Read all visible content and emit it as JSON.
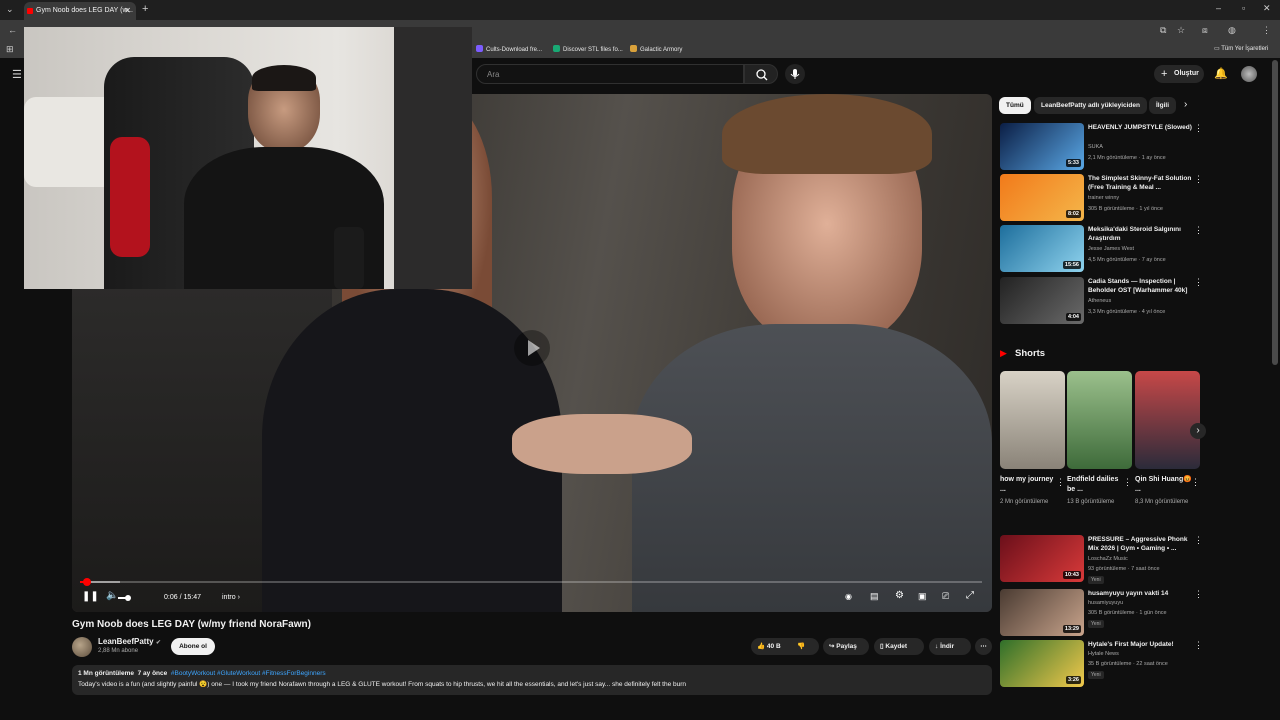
{
  "browser": {
    "tab_title": "Gym Noob does LEG DAY (w...",
    "bookmarks": [
      {
        "label": "Cults-Download fre...",
        "color": "#7c5cff"
      },
      {
        "label": "Discover STL files fo...",
        "color": "#19a974"
      },
      {
        "label": "Galactic Armory",
        "color": "#d9a13b"
      }
    ],
    "all_bookmarks": "Tüm Yer İşaretleri"
  },
  "header": {
    "search_placeholder": "Ara",
    "create_label": "Oluştur"
  },
  "player": {
    "time": "0:06 / 15:47",
    "chapter": "intro",
    "progress_fraction": 0.0063
  },
  "video": {
    "title": "Gym Noob does LEG DAY (w/my friend NoraFawn)",
    "channel": "LeanBeefPatty",
    "subscribers": "2,88 Mn abone",
    "subscribe_label": "Abone ol",
    "likes": "40 B",
    "share_label": "Paylaş",
    "save_label": "Kaydet",
    "download_label": "İndir",
    "desc_views": "1 Mn görüntüleme",
    "desc_age": "7 ay önce",
    "desc_tags": "#BootyWorkout #GluteWorkout #FitnessForBeginners",
    "desc_text": "Today's video is a fun (and slightly painful 😵) one — I took my friend Norafawn through a LEG & GLUTE workout! From squats to hip thrusts, we hit all the essentials, and let's just say... she definitely felt the burn"
  },
  "chips": [
    "Tümü",
    "LeanBeefPatty adlı yükleyiciden",
    "İlgili"
  ],
  "recs": [
    {
      "title": "HEAVENLY JUMPSTYLE (Slowed)",
      "channel": "SUKA",
      "meta": "2,1 Mn görüntüleme · 1 ay önce",
      "duration": "5:33",
      "colors": [
        "#0b1e45",
        "#5aa8e6"
      ]
    },
    {
      "title": "The Simplest Skinny-Fat Solution (Free Training & Meal ...",
      "channel": "trainer winny",
      "meta": "305 B görüntüleme · 1 yıl önce",
      "duration": "8:02",
      "colors": [
        "#f27a1a",
        "#f4b64a"
      ]
    },
    {
      "title": "Meksika'daki Steroid Salgınını Araştırdım",
      "channel": "Jesse James West",
      "meta": "4,5 Mn görüntüleme · 7 ay önce",
      "duration": "15:56",
      "colors": [
        "#1d6e9c",
        "#8fd3ee"
      ]
    },
    {
      "title": "Cadia Stands — Inspection | Beholder OST [Warhammer 40k]",
      "channel": "Atheneus",
      "meta": "3,3 Mn görüntüleme · 4 yıl önce",
      "duration": "4:04",
      "colors": [
        "#222222",
        "#6a6a6a"
      ]
    }
  ],
  "shorts_heading": "Shorts",
  "shorts": [
    {
      "title": "how my journey ...",
      "views": "2 Mn görüntüleme",
      "colors": [
        "#8a8378",
        "#d8d2c6"
      ]
    },
    {
      "title": "Endfield dailies be ...",
      "views": "13 B görüntüleme",
      "colors": [
        "#3e6b3a",
        "#9bc08c"
      ]
    },
    {
      "title": "Qin Shi Huang😡 ...",
      "views": "8,3 Mn görüntüleme",
      "colors": [
        "#2b2b3a",
        "#c74848"
      ]
    }
  ],
  "recs2": [
    {
      "title": "PRESSURE – Aggressive Phonk Mix 2026 | Gym • Gaming • ...",
      "channel": "LoschaZz Music",
      "meta": "93 görüntüleme · 7 saat önce",
      "badge": "Yeni",
      "duration": "10:43",
      "colors": [
        "#6b0f1a",
        "#d93a3a"
      ]
    },
    {
      "title": "husamyuyu yayın vakti 14",
      "channel": "husamiyuyuyu",
      "meta": "305 B görüntüleme · 1 gün önce",
      "badge": "Yeni",
      "duration": "13:29",
      "colors": [
        "#4a3b32",
        "#c9a48c"
      ]
    },
    {
      "title": "Hytale's First Major Update!",
      "channel": "Hytale News",
      "meta": "35 B görüntüleme · 22 saat önce",
      "badge": "Yeni",
      "duration": "3:26",
      "colors": [
        "#2f6f2a",
        "#f2c94c"
      ]
    }
  ]
}
